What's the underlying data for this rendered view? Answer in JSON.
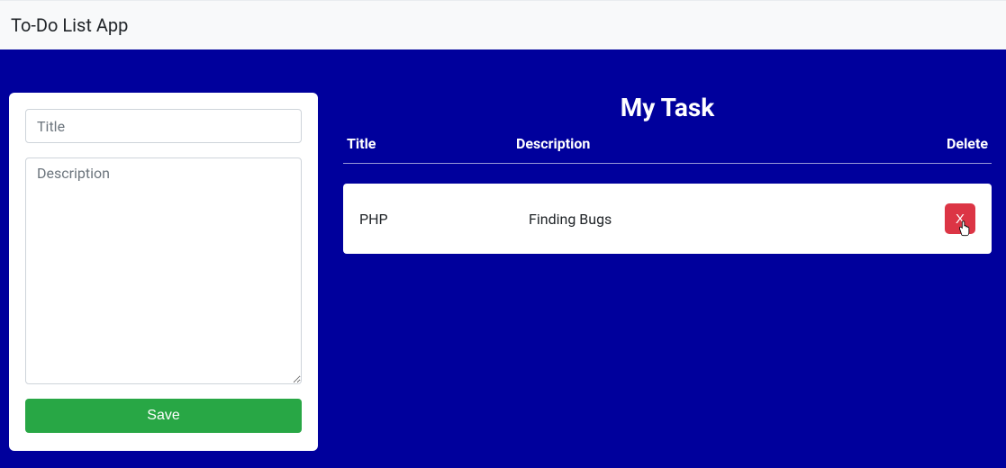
{
  "header": {
    "app_title": "To-Do List App"
  },
  "form": {
    "title_placeholder": "Title",
    "description_placeholder": "Description",
    "save_label": "Save"
  },
  "task_panel": {
    "heading": "My Task",
    "columns": {
      "title": "Title",
      "description": "Description",
      "delete": "Delete"
    }
  },
  "tasks": [
    {
      "title": "PHP",
      "description": "Finding Bugs",
      "delete_label": "X"
    }
  ]
}
